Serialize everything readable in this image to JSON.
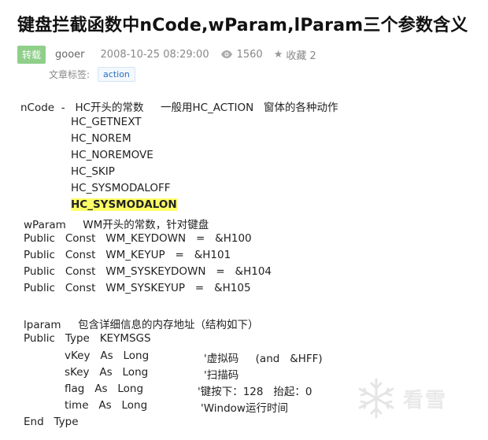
{
  "article": {
    "title": "键盘拦截函数中nCode,wParam,lParam三个参数含义",
    "badge": "转载",
    "author": "gooer",
    "date": "2008-10-25 08:29:00",
    "views": "1560",
    "favorite_label": "收藏 2",
    "tags_label": "文章标签:",
    "tags": [
      "action"
    ]
  },
  "content": {
    "l01": "nCode  -   HC开头的常数     一般用HC_ACTION   窗体的各种动作",
    "l02": "HC_GETNEXT",
    "l03": "HC_NOREM",
    "l04": "HC_NOREMOVE",
    "l05": "HC_SKIP",
    "l06": "HC_SYSMODALOFF",
    "l07": "HC_SYSMODALON",
    "l08": "wParam     WM开头的常数，针对键盘",
    "l09": "Public   Const   WM_KEYDOWN   =   &H100",
    "l10": "Public   Const   WM_KEYUP   =   &H101",
    "l11": "Public   Const   WM_SYSKEYDOWN   =   &H104",
    "l12": "Public   Const   WM_SYSKEYUP   =   &H105",
    "l13": "lparam     包含详细信息的内存地址（结构如下）",
    "l14": "Public   Type   KEYMSGS",
    "l15a": "vKey   As   Long",
    "l15b": "'虚拟码     (and   &HFF)",
    "l16a": "sKey   As   Long",
    "l16b": "'扫描码",
    "l17a": "flag   As   Long",
    "l17b": "'键按下：128   抬起：0",
    "l18a": "time   As   Long",
    "l18b": "'Window运行时间",
    "l19": "End   Type"
  },
  "watermark": {
    "text": "看雪",
    "icon": "snowflake-icon"
  }
}
